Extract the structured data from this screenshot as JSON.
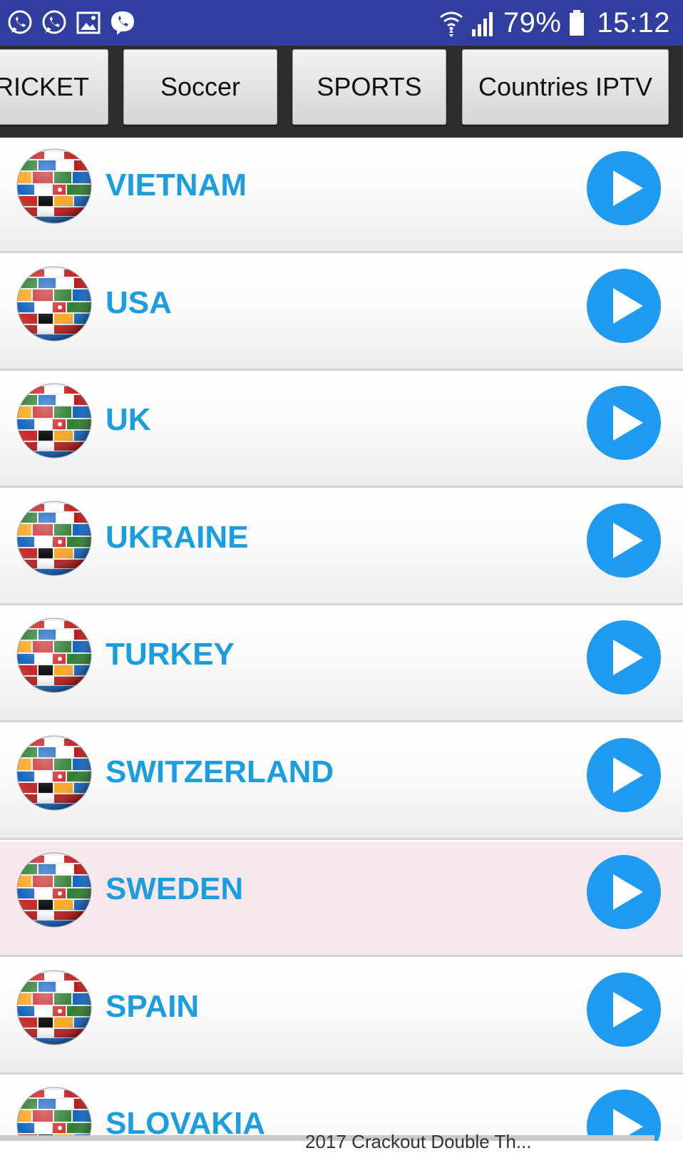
{
  "status_bar": {
    "notification_icons": [
      "whatsapp-icon",
      "whatsapp-icon",
      "image-icon",
      "viber-icon"
    ],
    "battery": "79%",
    "time": "15:12"
  },
  "tabs": [
    {
      "label": "RICKET"
    },
    {
      "label": "Soccer"
    },
    {
      "label": "SPORTS"
    },
    {
      "label": "Countries IPTV"
    }
  ],
  "channels": [
    {
      "name": "VIETNAM"
    },
    {
      "name": "USA"
    },
    {
      "name": "UK"
    },
    {
      "name": "UKRAINE"
    },
    {
      "name": "TURKEY"
    },
    {
      "name": "SWITZERLAND"
    },
    {
      "name": "SWEDEN"
    },
    {
      "name": "SPAIN"
    },
    {
      "name": "SLOVAKIA"
    }
  ],
  "footer": {
    "text": "2017 Crackout Double Th..."
  },
  "colors": {
    "status_bar": "#303f9f",
    "tab_bar": "#2d2d2d",
    "country_text": "#1a9ee0",
    "play_button": "#1e9bf0",
    "selected_row": "#f8e8ee"
  }
}
